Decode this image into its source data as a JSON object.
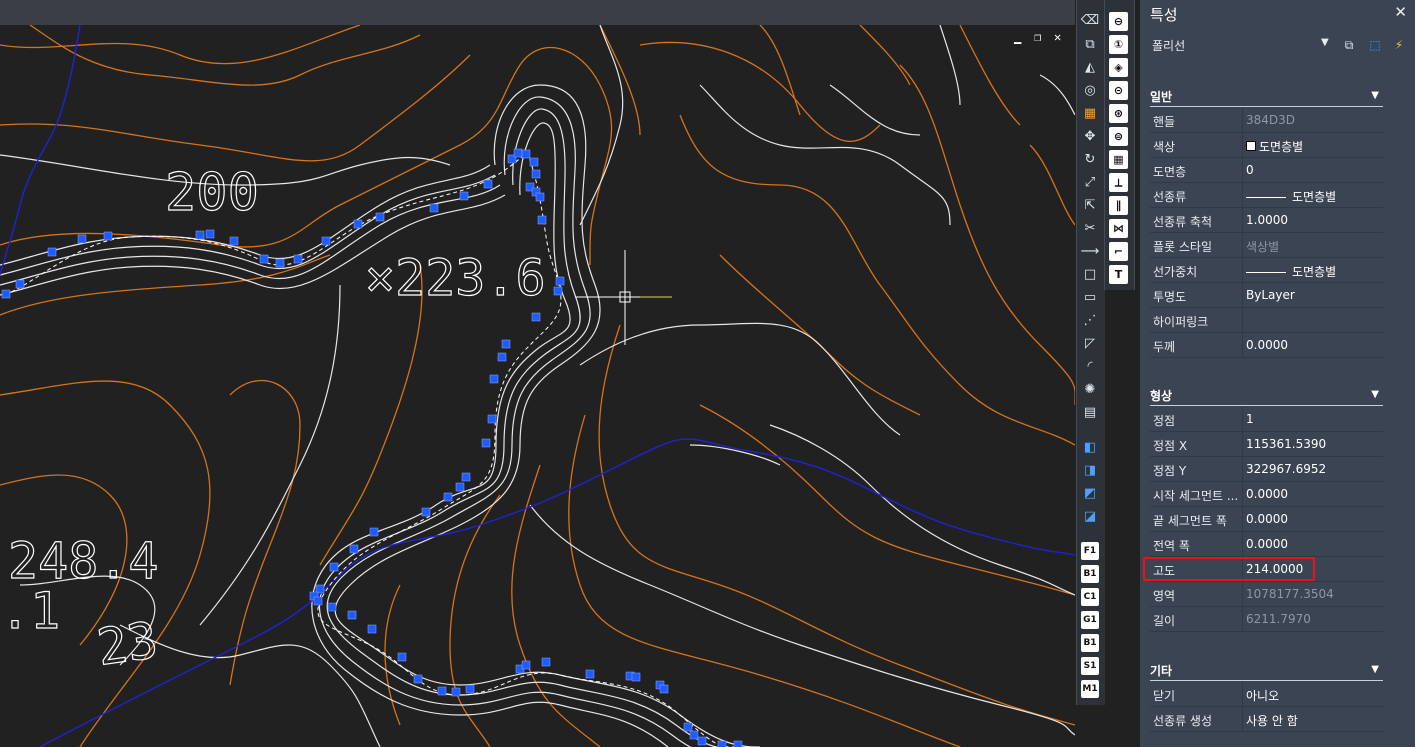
{
  "drawing": {
    "labels": [
      "200",
      "×223.6",
      "248.4",
      ".1",
      "23"
    ],
    "viewport_controls": [
      "▁",
      "❐",
      "✕"
    ],
    "colors": {
      "contour_orange": "#d6731b",
      "contour_white": "#e6e6e6",
      "stream_blue": "#1f22d8",
      "grip_blue": "#1f5cff"
    }
  },
  "panel": {
    "title": "특성",
    "close": "✕",
    "object_type": "폴리선",
    "dropdown": "▼",
    "toolbar_icons": [
      "quick-select-icon",
      "select-objects-icon",
      "toggle-pickadd-icon"
    ],
    "sections": [
      {
        "title": "일반",
        "rows": [
          {
            "label": "핸들",
            "value": "384D3D",
            "dim": true
          },
          {
            "label": "색상",
            "value": "도면층별",
            "swatch": true
          },
          {
            "label": "도면층",
            "value": "0"
          },
          {
            "label": "선종류",
            "value": "도면층별",
            "line": true
          },
          {
            "label": "선종류 축척",
            "value": "1.0000"
          },
          {
            "label": "플롯 스타일",
            "value": "색상별",
            "dim": true
          },
          {
            "label": "선가중치",
            "value": "도면층별",
            "line": true
          },
          {
            "label": "투명도",
            "value": "ByLayer"
          },
          {
            "label": "하이퍼링크",
            "value": ""
          },
          {
            "label": "두께",
            "value": "0.0000"
          }
        ]
      },
      {
        "title": "형상",
        "rows": [
          {
            "label": "정점",
            "value": "1"
          },
          {
            "label": "정점 X",
            "value": "115361.5390"
          },
          {
            "label": "정점 Y",
            "value": "322967.6952"
          },
          {
            "label": "시작 세그먼트 ...",
            "value": "0.0000"
          },
          {
            "label": "끝 세그먼트 폭",
            "value": "0.0000"
          },
          {
            "label": "전역 폭",
            "value": "0.0000"
          },
          {
            "label": "고도",
            "value": "214.0000"
          },
          {
            "label": "영역",
            "value": "1078177.3504",
            "dim": true
          },
          {
            "label": "길이",
            "value": "6211.7970",
            "dim": true
          }
        ]
      },
      {
        "title": "기타",
        "rows": [
          {
            "label": "닫기",
            "value": "아니오"
          },
          {
            "label": "선종류 생성",
            "value": "사용 안 함"
          }
        ]
      }
    ]
  },
  "toolbar_right_labels": [
    "F1",
    "B1",
    "C1",
    "G1",
    "B1",
    "S1",
    "M1"
  ]
}
